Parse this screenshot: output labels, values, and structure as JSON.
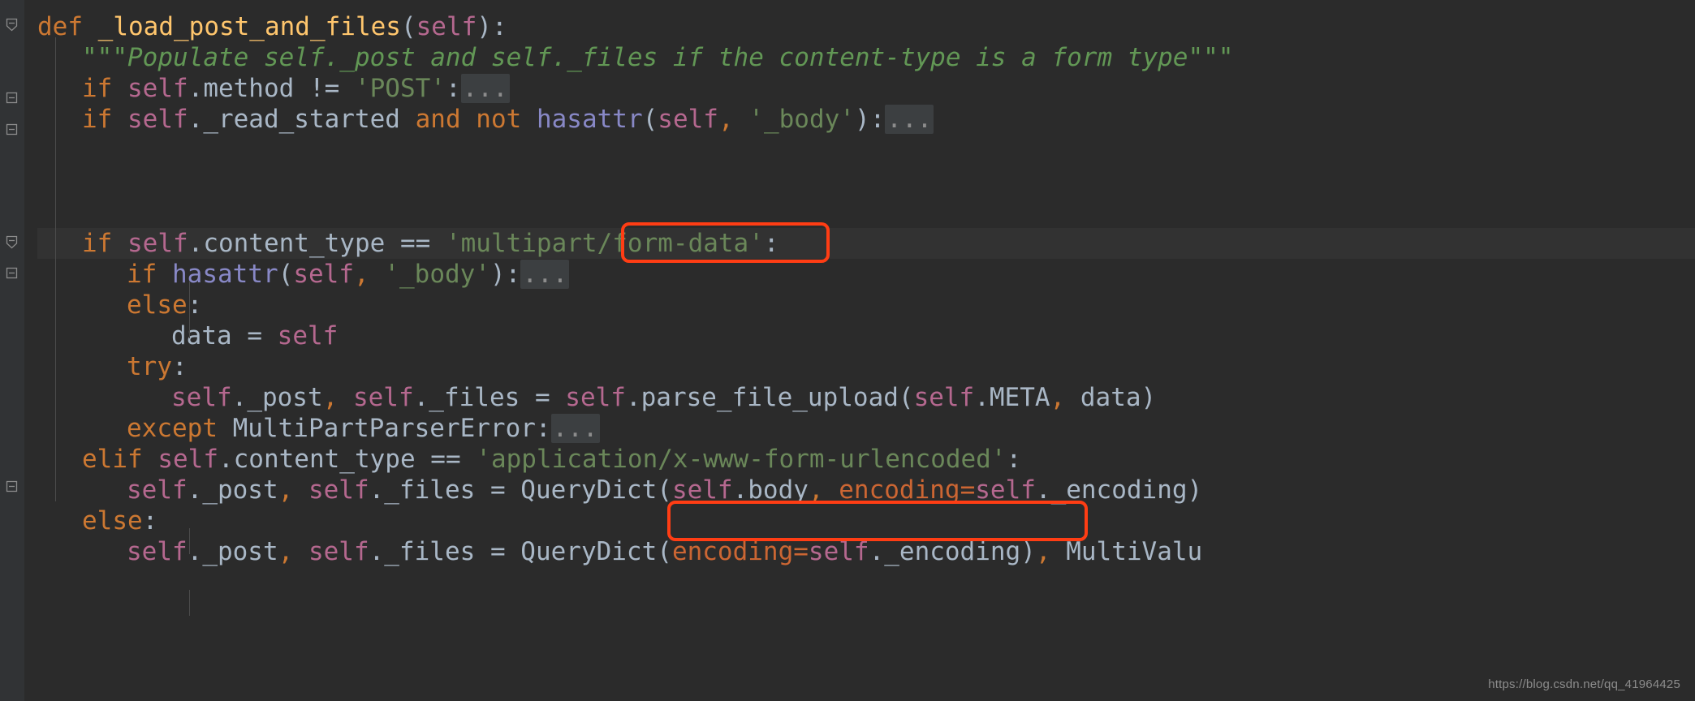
{
  "editor": {
    "background_color": "#2b2b2b",
    "gutter_color": "#313335",
    "caret_line_color": "#323232",
    "annotation_color": "#ff3d14",
    "colors": {
      "keyword": "#cc7832",
      "self": "#b5688f",
      "identifier": "#a9b7c6",
      "function": "#ffc66d",
      "string": "#6a8759",
      "docstring": "#629755",
      "parameter": "#cc6633",
      "builtin": "#8888c6",
      "fold_chip": "#3c3f41"
    }
  },
  "code_lines": [
    {
      "id": "line-def",
      "indent": 0,
      "text": "def _load_post_and_files(self):",
      "tokens": [
        {
          "t": "def",
          "c": "kw"
        },
        {
          "t": " ",
          "c": "id"
        },
        {
          "t": "_load_post_and_files",
          "c": "fn"
        },
        {
          "t": "(",
          "c": "punct"
        },
        {
          "t": "self",
          "c": "self"
        },
        {
          "t": "):",
          "c": "punct"
        }
      ]
    },
    {
      "id": "line-docstring",
      "indent": 1,
      "text": "\"\"\"Populate self._post and self._files if the content-type is a form type\"\"\"",
      "tokens": [
        {
          "t": "\"\"\"",
          "c": "doc-quote"
        },
        {
          "t": "Populate self._post and self._files if the content-type is a form type\"\"\"",
          "c": "doc"
        }
      ]
    },
    {
      "id": "line-if-method",
      "indent": 1,
      "text": "if self.method != 'POST':",
      "fold": true,
      "tokens": [
        {
          "t": "if",
          "c": "kw"
        },
        {
          "t": " ",
          "c": "id"
        },
        {
          "t": "self",
          "c": "self"
        },
        {
          "t": ".method ",
          "c": "id"
        },
        {
          "t": "!=",
          "c": "op"
        },
        {
          "t": " ",
          "c": "id"
        },
        {
          "t": "'POST'",
          "c": "str"
        },
        {
          "t": ":",
          "c": "punct"
        }
      ]
    },
    {
      "id": "line-if-read-started",
      "indent": 1,
      "text": "if self._read_started and not hasattr(self, '_body'):",
      "fold": true,
      "tokens": [
        {
          "t": "if",
          "c": "kw"
        },
        {
          "t": " ",
          "c": "id"
        },
        {
          "t": "self",
          "c": "self"
        },
        {
          "t": "._read_started ",
          "c": "id"
        },
        {
          "t": "and",
          "c": "kw"
        },
        {
          "t": " ",
          "c": "id"
        },
        {
          "t": "not",
          "c": "kw"
        },
        {
          "t": " ",
          "c": "id"
        },
        {
          "t": "hasattr",
          "c": "bi"
        },
        {
          "t": "(",
          "c": "punct"
        },
        {
          "t": "self",
          "c": "self"
        },
        {
          "t": ",",
          "c": "comma"
        },
        {
          "t": " ",
          "c": "id"
        },
        {
          "t": "'_body'",
          "c": "str"
        },
        {
          "t": "):",
          "c": "punct"
        }
      ]
    },
    {
      "id": "line-blank-1",
      "indent": 0,
      "text": "",
      "tokens": []
    },
    {
      "id": "line-if-multipart",
      "indent": 1,
      "highlighted": true,
      "text": "if self.content_type == 'multipart/form-data':",
      "tokens": [
        {
          "t": "if",
          "c": "kw"
        },
        {
          "t": " ",
          "c": "id"
        },
        {
          "t": "self",
          "c": "self"
        },
        {
          "t": ".content_type ",
          "c": "id"
        },
        {
          "t": "==",
          "c": "op"
        },
        {
          "t": " ",
          "c": "id"
        },
        {
          "t": "'multipart/form-data'",
          "c": "str"
        },
        {
          "t": ":",
          "c": "punct"
        }
      ]
    },
    {
      "id": "line-if-hasattr-body",
      "indent": 2,
      "text": "if hasattr(self, '_body'):",
      "fold": true,
      "tokens": [
        {
          "t": "if",
          "c": "kw"
        },
        {
          "t": " ",
          "c": "id"
        },
        {
          "t": "hasattr",
          "c": "bi"
        },
        {
          "t": "(",
          "c": "punct"
        },
        {
          "t": "self",
          "c": "self"
        },
        {
          "t": ",",
          "c": "comma"
        },
        {
          "t": " ",
          "c": "id"
        },
        {
          "t": "'_body'",
          "c": "str"
        },
        {
          "t": "):",
          "c": "punct"
        }
      ]
    },
    {
      "id": "line-else-1",
      "indent": 2,
      "text": "else:",
      "tokens": [
        {
          "t": "else",
          "c": "kw"
        },
        {
          "t": ":",
          "c": "punct"
        }
      ]
    },
    {
      "id": "line-data-self",
      "indent": 3,
      "text": "data = self",
      "tokens": [
        {
          "t": "data ",
          "c": "id"
        },
        {
          "t": "=",
          "c": "op"
        },
        {
          "t": " ",
          "c": "id"
        },
        {
          "t": "self",
          "c": "self"
        }
      ]
    },
    {
      "id": "line-try",
      "indent": 2,
      "text": "try:",
      "tokens": [
        {
          "t": "try",
          "c": "kw"
        },
        {
          "t": ":",
          "c": "punct"
        }
      ]
    },
    {
      "id": "line-parse-file-upload",
      "indent": 3,
      "text": "self._post, self._files = self.parse_file_upload(self.META, data)",
      "tokens": [
        {
          "t": "self",
          "c": "self"
        },
        {
          "t": "._post",
          "c": "id"
        },
        {
          "t": ",",
          "c": "comma"
        },
        {
          "t": " ",
          "c": "id"
        },
        {
          "t": "self",
          "c": "self"
        },
        {
          "t": "._files ",
          "c": "id"
        },
        {
          "t": "=",
          "c": "op"
        },
        {
          "t": " ",
          "c": "id"
        },
        {
          "t": "self",
          "c": "self"
        },
        {
          "t": ".parse_file_upload(",
          "c": "id"
        },
        {
          "t": "self",
          "c": "self"
        },
        {
          "t": ".META",
          "c": "id"
        },
        {
          "t": ",",
          "c": "comma"
        },
        {
          "t": " data)",
          "c": "id"
        }
      ]
    },
    {
      "id": "line-except",
      "indent": 2,
      "text": "except MultiPartParserError:",
      "fold": true,
      "tokens": [
        {
          "t": "except",
          "c": "kw"
        },
        {
          "t": " MultiPartParserError:",
          "c": "id"
        }
      ]
    },
    {
      "id": "line-elif-urlencoded",
      "indent": 1,
      "text": "elif self.content_type == 'application/x-www-form-urlencoded':",
      "tokens": [
        {
          "t": "elif",
          "c": "kw"
        },
        {
          "t": " ",
          "c": "id"
        },
        {
          "t": "self",
          "c": "self"
        },
        {
          "t": ".content_type ",
          "c": "id"
        },
        {
          "t": "==",
          "c": "op"
        },
        {
          "t": " ",
          "c": "id"
        },
        {
          "t": "'application/x-www-form-urlencoded'",
          "c": "str"
        },
        {
          "t": ":",
          "c": "punct"
        }
      ]
    },
    {
      "id": "line-querydict-body",
      "indent": 2,
      "text": "self._post, self._files = QueryDict(self.body, encoding=self._encoding)",
      "tokens": [
        {
          "t": "self",
          "c": "self"
        },
        {
          "t": "._post",
          "c": "id"
        },
        {
          "t": ",",
          "c": "comma"
        },
        {
          "t": " ",
          "c": "id"
        },
        {
          "t": "self",
          "c": "self"
        },
        {
          "t": "._files ",
          "c": "id"
        },
        {
          "t": "=",
          "c": "op"
        },
        {
          "t": " QueryDict(",
          "c": "id"
        },
        {
          "t": "self",
          "c": "self"
        },
        {
          "t": ".body",
          "c": "id"
        },
        {
          "t": ",",
          "c": "comma"
        },
        {
          "t": " ",
          "c": "id"
        },
        {
          "t": "encoding",
          "c": "param"
        },
        {
          "t": "=",
          "c": "param"
        },
        {
          "t": "self",
          "c": "self"
        },
        {
          "t": "._encoding)",
          "c": "id"
        }
      ]
    },
    {
      "id": "line-else-2",
      "indent": 1,
      "text": "else:",
      "tokens": [
        {
          "t": "else",
          "c": "kw"
        },
        {
          "t": ":",
          "c": "punct"
        }
      ]
    },
    {
      "id": "line-querydict-empty",
      "indent": 2,
      "text": "self._post, self._files = QueryDict(encoding=self._encoding), MultiValu",
      "tokens": [
        {
          "t": "self",
          "c": "self"
        },
        {
          "t": "._post",
          "c": "id"
        },
        {
          "t": ",",
          "c": "comma"
        },
        {
          "t": " ",
          "c": "id"
        },
        {
          "t": "self",
          "c": "self"
        },
        {
          "t": "._files ",
          "c": "id"
        },
        {
          "t": "=",
          "c": "op"
        },
        {
          "t": " QueryDict(",
          "c": "id"
        },
        {
          "t": "encoding",
          "c": "param"
        },
        {
          "t": "=",
          "c": "param"
        },
        {
          "t": "self",
          "c": "self"
        },
        {
          "t": "._encoding)",
          "c": "id"
        },
        {
          "t": ",",
          "c": "comma"
        },
        {
          "t": " MultiValu",
          "c": "id"
        }
      ]
    }
  ],
  "fold_chip_label": "...",
  "annotations": [
    {
      "id": "annotation-multipart",
      "label": "'multipart/form-data':"
    },
    {
      "id": "annotation-urlencoded",
      "label": "'application/x-www-form-urlencoded':"
    }
  ],
  "watermark": {
    "text": "https://blog.csdn.net/qq_41964425"
  }
}
